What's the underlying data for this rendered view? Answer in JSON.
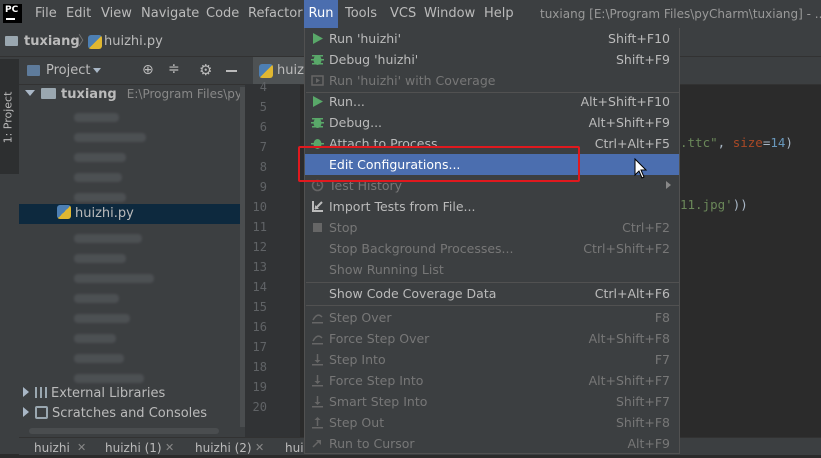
{
  "menubar": {
    "logo": "PC",
    "items": [
      "File",
      "Edit",
      "View",
      "Navigate",
      "Code",
      "Refactor",
      "Run",
      "Tools",
      "VCS",
      "Window",
      "Help"
    ],
    "active": "Run",
    "window_title": "tuxiang [E:\\Program Files\\pyCharm\\tuxiang] - ...\\"
  },
  "navbar": {
    "project": "tuxiang",
    "file": "huizhi.py"
  },
  "tool_strip": {
    "project_tab": "1: Project"
  },
  "project_panel": {
    "header": "Project",
    "root_name": "tuxiang",
    "root_path": "E:\\Program Files\\pyCha",
    "selected_file": "huizhi.py",
    "external_libraries": "External Libraries",
    "scratches": "Scratches and Consoles"
  },
  "editor": {
    "tab": "huiz",
    "line_numbers": [
      "4",
      "5",
      "6",
      "7",
      "8",
      "9",
      "10",
      "11",
      "12",
      "13",
      "14",
      "15",
      "16",
      "17",
      "18",
      "19",
      "20"
    ],
    "code_fragment_1a": ".ttc\"",
    "code_fragment_1b": ", ",
    "code_fragment_1c": "size",
    "code_fragment_1d": "=",
    "code_fragment_1e": "14",
    "code_fragment_1f": ")",
    "code_fragment_2a": "11.jpg'",
    "code_fragment_2b": "))"
  },
  "bottom_tabs": [
    "huizhi",
    "huizhi (1)",
    "huizhi (2)",
    "hui"
  ],
  "run_menu": {
    "items": [
      {
        "label": "Run 'huizhi'",
        "shortcut": "Shift+F10",
        "enabled": true,
        "icon": "run-icon"
      },
      {
        "label": "Debug 'huizhi'",
        "shortcut": "Shift+F9",
        "enabled": true,
        "icon": "debug-icon"
      },
      {
        "label": "Run 'huizhi' with Coverage",
        "shortcut": "",
        "enabled": false,
        "icon": "coverage-icon"
      },
      {
        "label": "Run...",
        "shortcut": "Alt+Shift+F10",
        "enabled": true,
        "icon": "run-icon"
      },
      {
        "label": "Debug...",
        "shortcut": "Alt+Shift+F9",
        "enabled": true,
        "icon": "debug-icon"
      },
      {
        "label": "Attach to Process...",
        "shortcut": "Ctrl+Alt+F5",
        "enabled": true,
        "icon": "attach-icon"
      },
      {
        "label": "Edit Configurations...",
        "shortcut": "",
        "enabled": true,
        "icon": "",
        "highlighted": true
      },
      {
        "label": "Test History",
        "shortcut": "",
        "enabled": false,
        "icon": "history-icon",
        "submenu": true
      },
      {
        "label": "Import Tests from File...",
        "shortcut": "",
        "enabled": true,
        "icon": "import-icon"
      },
      {
        "label": "Stop",
        "shortcut": "Ctrl+F2",
        "enabled": false,
        "icon": "stop-icon"
      },
      {
        "label": "Stop Background Processes...",
        "shortcut": "Ctrl+Shift+F2",
        "enabled": false,
        "icon": ""
      },
      {
        "label": "Show Running List",
        "shortcut": "",
        "enabled": false,
        "icon": ""
      },
      {
        "label": "Show Code Coverage Data",
        "shortcut": "Ctrl+Alt+F6",
        "enabled": true,
        "icon": ""
      },
      {
        "label": "Step Over",
        "shortcut": "F8",
        "enabled": false,
        "icon": "step-over-icon"
      },
      {
        "label": "Force Step Over",
        "shortcut": "Alt+Shift+F8",
        "enabled": false,
        "icon": "force-step-over-icon"
      },
      {
        "label": "Step Into",
        "shortcut": "F7",
        "enabled": false,
        "icon": "step-into-icon"
      },
      {
        "label": "Force Step Into",
        "shortcut": "Alt+Shift+F7",
        "enabled": false,
        "icon": "force-step-into-icon"
      },
      {
        "label": "Smart Step Into",
        "shortcut": "Shift+F7",
        "enabled": false,
        "icon": "smart-step-into-icon"
      },
      {
        "label": "Step Out",
        "shortcut": "Shift+F8",
        "enabled": false,
        "icon": "step-out-icon"
      },
      {
        "label": "Run to Cursor",
        "shortcut": "Alt+F9",
        "enabled": false,
        "icon": "run-to-cursor-icon"
      }
    ]
  },
  "colors": {
    "accent": "#4b6eaf",
    "run_green": "#59a869",
    "highlight_box": "#e0191e"
  }
}
